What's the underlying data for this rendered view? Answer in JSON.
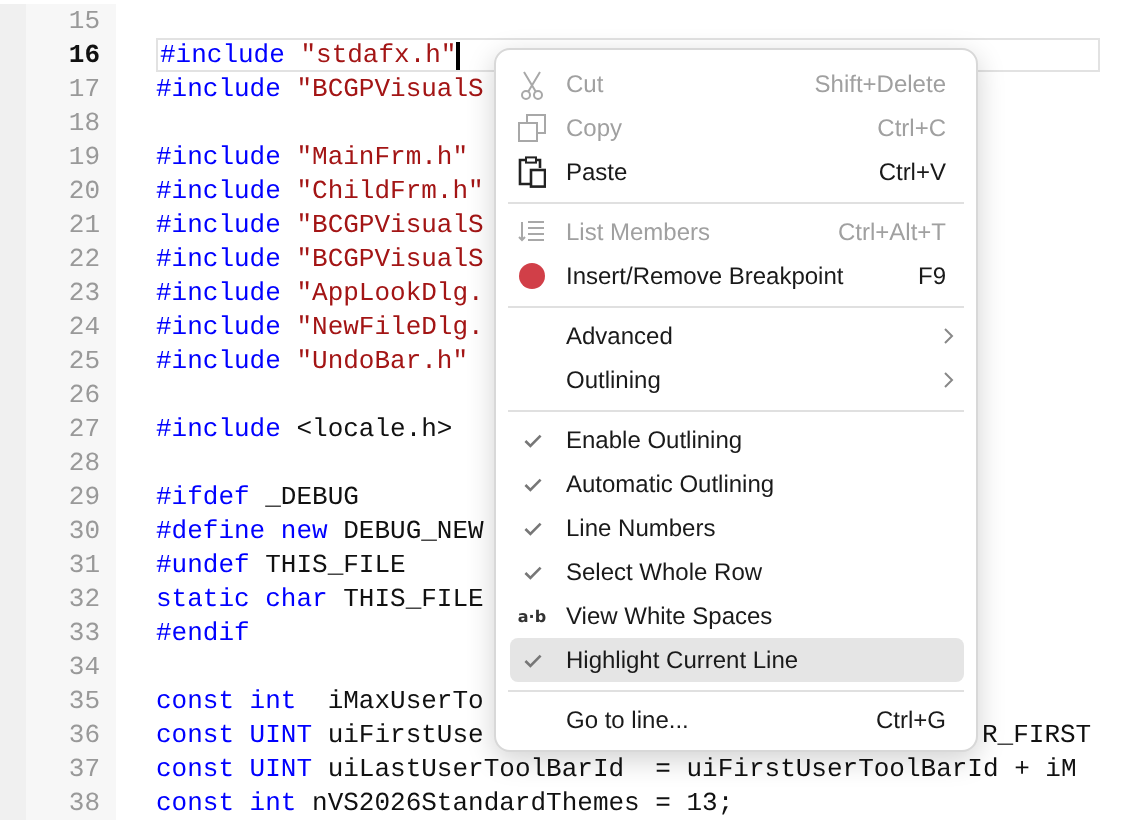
{
  "editor": {
    "lines": [
      {
        "number": "15",
        "current": false
      },
      {
        "number": "16",
        "current": true,
        "segments": [
          {
            "text": "#include ",
            "kind": "keyword"
          },
          {
            "text": "\"stdafx.h\"",
            "kind": "string"
          }
        ]
      },
      {
        "number": "17",
        "current": false,
        "segments": [
          {
            "text": "#include ",
            "kind": "keyword"
          },
          {
            "text": "\"BCGPVisualS",
            "kind": "string"
          }
        ]
      },
      {
        "number": "18",
        "current": false
      },
      {
        "number": "19",
        "current": false,
        "segments": [
          {
            "text": "#include ",
            "kind": "keyword"
          },
          {
            "text": "\"MainFrm.h\"",
            "kind": "string"
          }
        ]
      },
      {
        "number": "20",
        "current": false,
        "segments": [
          {
            "text": "#include ",
            "kind": "keyword"
          },
          {
            "text": "\"ChildFrm.h\"",
            "kind": "string"
          }
        ]
      },
      {
        "number": "21",
        "current": false,
        "segments": [
          {
            "text": "#include ",
            "kind": "keyword"
          },
          {
            "text": "\"BCGPVisualS",
            "kind": "string"
          }
        ]
      },
      {
        "number": "22",
        "current": false,
        "segments": [
          {
            "text": "#include ",
            "kind": "keyword"
          },
          {
            "text": "\"BCGPVisualS",
            "kind": "string"
          }
        ]
      },
      {
        "number": "23",
        "current": false,
        "segments": [
          {
            "text": "#include ",
            "kind": "keyword"
          },
          {
            "text": "\"AppLookDlg.",
            "kind": "string"
          }
        ]
      },
      {
        "number": "24",
        "current": false,
        "segments": [
          {
            "text": "#include ",
            "kind": "keyword"
          },
          {
            "text": "\"NewFileDlg.",
            "kind": "string"
          }
        ]
      },
      {
        "number": "25",
        "current": false,
        "segments": [
          {
            "text": "#include ",
            "kind": "keyword"
          },
          {
            "text": "\"UndoBar.h\"",
            "kind": "string"
          }
        ]
      },
      {
        "number": "26",
        "current": false
      },
      {
        "number": "27",
        "current": false,
        "segments": [
          {
            "text": "#include ",
            "kind": "keyword"
          },
          {
            "text": "<locale.h>",
            "kind": "plain"
          }
        ]
      },
      {
        "number": "28",
        "current": false
      },
      {
        "number": "29",
        "current": false,
        "segments": [
          {
            "text": "#ifdef ",
            "kind": "keyword"
          },
          {
            "text": "_DEBUG",
            "kind": "plain"
          }
        ]
      },
      {
        "number": "30",
        "current": false,
        "segments": [
          {
            "text": "#define new ",
            "kind": "keyword"
          },
          {
            "text": "DEBUG_NEW",
            "kind": "plain"
          }
        ]
      },
      {
        "number": "31",
        "current": false,
        "segments": [
          {
            "text": "#undef ",
            "kind": "keyword"
          },
          {
            "text": "THIS_FILE",
            "kind": "plain"
          }
        ]
      },
      {
        "number": "32",
        "current": false,
        "segments": [
          {
            "text": "static char ",
            "kind": "keyword"
          },
          {
            "text": "THIS_FILE",
            "kind": "plain"
          }
        ]
      },
      {
        "number": "33",
        "current": false,
        "segments": [
          {
            "text": "#endif",
            "kind": "keyword"
          }
        ]
      },
      {
        "number": "34",
        "current": false
      },
      {
        "number": "35",
        "current": false,
        "segments": [
          {
            "text": "const int  ",
            "kind": "keyword"
          },
          {
            "text": "iMaxUserTo",
            "kind": "plain"
          }
        ]
      },
      {
        "number": "36",
        "current": false,
        "segments": [
          {
            "text": "const UINT ",
            "kind": "keyword"
          },
          {
            "text": "uiFirstUse",
            "kind": "plain"
          },
          {
            "text": "R_FIRST",
            "kind": "tail"
          }
        ]
      },
      {
        "number": "37",
        "current": false,
        "segments": [
          {
            "text": "const UINT ",
            "kind": "keyword"
          },
          {
            "text": "uiLastUserToolBarId  = uiFirstUserToolBarId + iM",
            "kind": "plain"
          }
        ]
      },
      {
        "number": "38",
        "current": false,
        "segments": [
          {
            "text": "const int ",
            "kind": "keyword"
          },
          {
            "text": "nVS2026StandardThemes = 13;",
            "kind": "plain"
          }
        ]
      }
    ]
  },
  "context_menu": {
    "items": [
      {
        "kind": "cut",
        "label": "Cut",
        "shortcut": "Shift+Delete",
        "disabled": true
      },
      {
        "kind": "copy",
        "label": "Copy",
        "shortcut": "Ctrl+C",
        "disabled": true
      },
      {
        "kind": "paste",
        "label": "Paste",
        "shortcut": "Ctrl+V",
        "disabled": false
      },
      {
        "kind": "separator"
      },
      {
        "kind": "members",
        "label": "List Members",
        "shortcut": "Ctrl+Alt+T",
        "disabled": true
      },
      {
        "kind": "breakpoint",
        "label": "Insert/Remove Breakpoint",
        "shortcut": "F9",
        "disabled": false
      },
      {
        "kind": "separator"
      },
      {
        "kind": "submenu",
        "label": "Advanced"
      },
      {
        "kind": "submenu",
        "label": "Outlining"
      },
      {
        "kind": "separator"
      },
      {
        "kind": "toggle",
        "label": "Enable Outlining",
        "checked": true,
        "selected": false
      },
      {
        "kind": "toggle",
        "label": "Automatic Outlining",
        "checked": true,
        "selected": false
      },
      {
        "kind": "toggle",
        "label": "Line Numbers",
        "checked": true,
        "selected": false
      },
      {
        "kind": "toggle",
        "label": "Select Whole Row",
        "checked": true,
        "selected": false
      },
      {
        "kind": "toggle",
        "label": "View White Spaces",
        "checked": false,
        "glyph": "a·b",
        "selected": false
      },
      {
        "kind": "toggle",
        "label": "Highlight Current Line",
        "checked": true,
        "selected": true
      },
      {
        "kind": "separator"
      },
      {
        "kind": "item",
        "label": "Go to line...",
        "shortcut": "Ctrl+G",
        "disabled": false
      }
    ]
  }
}
